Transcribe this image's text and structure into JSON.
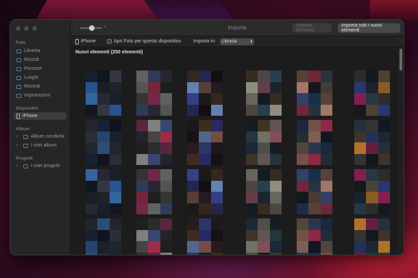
{
  "window": {
    "title": "Importa"
  },
  "sidebar": {
    "sections": [
      {
        "title": "Foto",
        "items": [
          "Libreria",
          "Ricordi",
          "Persone",
          "Luoghi",
          "Recenti",
          "Importazioni"
        ]
      },
      {
        "title": "Dispositivi",
        "items": [
          "iPhone"
        ]
      },
      {
        "title": "Album",
        "items": [
          "Album condivisi",
          "I miei album"
        ]
      },
      {
        "title": "Progetti",
        "items": [
          "I miei progetti"
        ]
      }
    ]
  },
  "toolbar": {
    "zoom_minus": "-",
    "zoom_plus": "+",
    "import_selected_label": "Importa elementi",
    "import_all_label": "Importa tutti i nuovi elementi"
  },
  "subbar": {
    "device": "iPhone",
    "open_photos_label": "Apri Foto per questo dispositivo",
    "import_in_label": "Importa in:",
    "destination": "Libreria"
  },
  "content": {
    "section_title": "Nuovi elementi (250 elementi)"
  },
  "colors": {
    "window_bg": "#1e1e1e",
    "sidebar_bg": "#262626",
    "selected_item": "#3c3c3c",
    "accent_icon": "#5a7aa8"
  }
}
